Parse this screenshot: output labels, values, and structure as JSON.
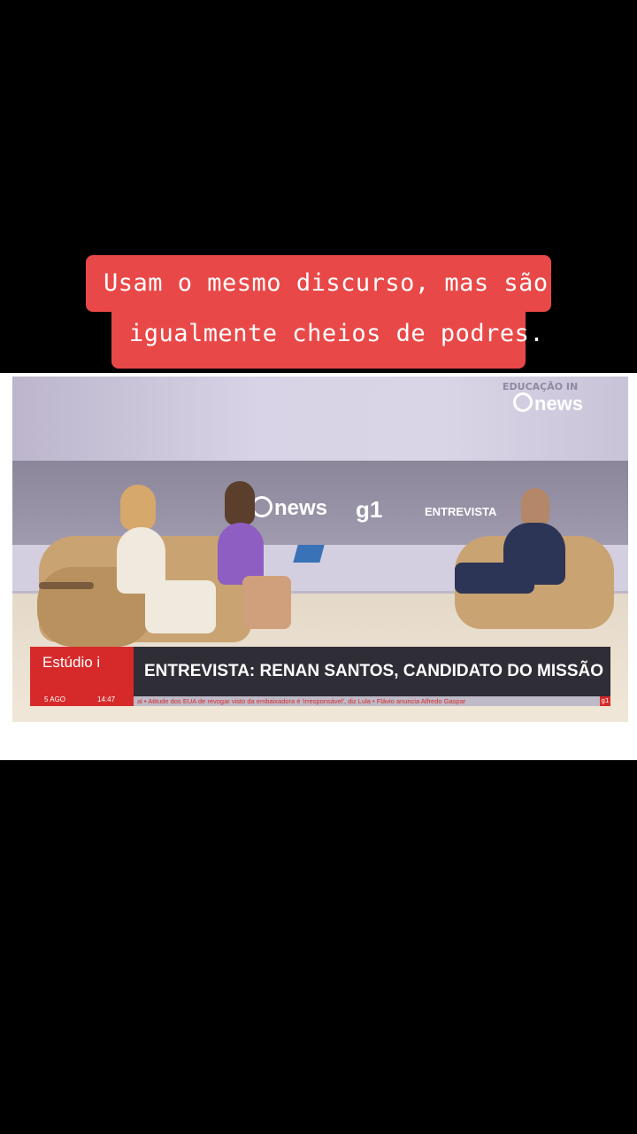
{
  "caption": {
    "line1": "Usam o mesmo discurso, mas são",
    "line2": "igualmente cheios de podres."
  },
  "video": {
    "corner_logo": "news",
    "corner_label": "EDUCAÇÃO IN",
    "studio_logo": "news",
    "studio_g1": "g1",
    "studio_label": "ENTREVISTA",
    "lower_third": {
      "program": "Estúdio i",
      "date": "5 AGO",
      "time": "14:47",
      "headline": "ENTREVISTA: RENAN SANTOS, CANDIDATO DO MISSÃO",
      "ticker": "al • Atitude dos EUA de revogar visto da embaixadora é 'irresponsável', diz Lula • Flávio anuncia Alfredo Gaspar",
      "ticker_badge": "g1"
    }
  }
}
